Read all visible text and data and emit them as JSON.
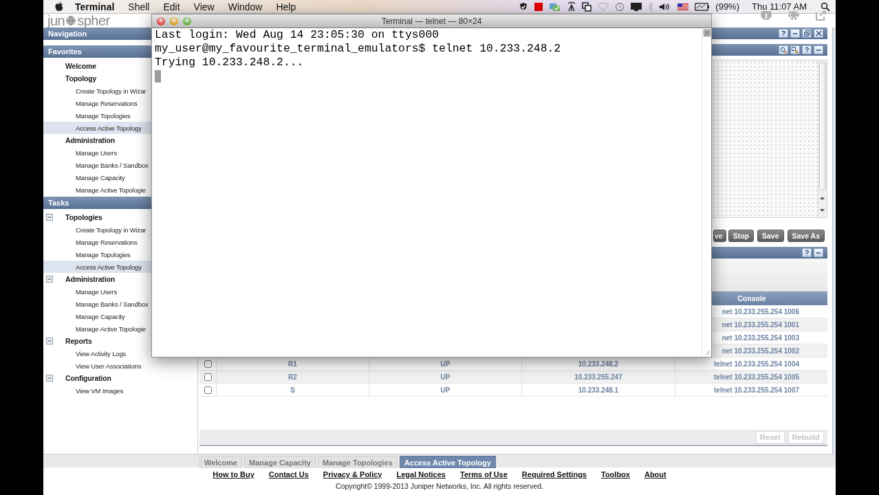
{
  "menu_bar": {
    "app": "Terminal",
    "menus": [
      "Shell",
      "Edit",
      "View",
      "Window",
      "Help"
    ],
    "battery": "(99%)",
    "clock": "Thu 11:07 AM"
  },
  "logo": {
    "before": "jun",
    "after": "spher"
  },
  "navigation": {
    "title": "Navigation"
  },
  "favorites": {
    "title": "Favorites",
    "groups": [
      {
        "label": "Welcome"
      },
      {
        "label": "Topology",
        "children": [
          {
            "label": "Create Topology in Wizar",
            "selected": false
          },
          {
            "label": "Manage Reservations",
            "selected": false
          },
          {
            "label": "Manage Topologies",
            "selected": false
          },
          {
            "label": "Access Active Topology",
            "selected": true
          }
        ]
      },
      {
        "label": "Administration",
        "children": [
          {
            "label": "Manage Users",
            "selected": false
          },
          {
            "label": "Manage Banks / Sandbox",
            "selected": false
          },
          {
            "label": "Manage Capacity",
            "selected": false
          },
          {
            "label": "Manage Active Topologie",
            "selected": false
          }
        ]
      }
    ]
  },
  "tasks": {
    "title": "Tasks",
    "groups": [
      {
        "label": "Topologies",
        "expanded": true,
        "children": [
          {
            "label": "Create Topology in Wizar",
            "selected": false
          },
          {
            "label": "Manage Reservations",
            "selected": false
          },
          {
            "label": "Manage Topologies",
            "selected": false
          },
          {
            "label": "Access Active Topology",
            "selected": true
          }
        ]
      },
      {
        "label": "Administration",
        "expanded": true,
        "children": [
          {
            "label": "Manage Users",
            "selected": false
          },
          {
            "label": "Manage Banks / Sandbox",
            "selected": false
          },
          {
            "label": "Manage Capacity",
            "selected": false
          },
          {
            "label": "Manage Active Topologie",
            "selected": false
          }
        ]
      },
      {
        "label": "Reports",
        "expanded": true,
        "children": [
          {
            "label": "View Activity Logs",
            "selected": false
          },
          {
            "label": "View User Associations",
            "selected": false
          }
        ]
      },
      {
        "label": "Configuration",
        "expanded": true,
        "children": [
          {
            "label": "View VM Images",
            "selected": false
          }
        ]
      }
    ]
  },
  "terminal": {
    "title": "Terminal — telnet — 80×24",
    "lines": [
      "Last login: Wed Aug 14 23:05:30 on ttys000",
      "my_user@my_favourite_terminal_emulators$ telnet 10.233.248.2",
      "Trying 10.233.248.2..."
    ]
  },
  "topology_toolbar": {
    "buttons": [
      "ve",
      "Stop",
      "Save",
      "Save As"
    ]
  },
  "devices_table": {
    "columns": [
      "Console"
    ],
    "rows": [
      {
        "console": "net 10.233.255.254 1006"
      },
      {
        "console": "net 10.233.255.254 1001"
      },
      {
        "console": "net 10.233.255.254 1003"
      },
      {
        "console": "net 10.233.255.254 1002"
      },
      {
        "checked": false,
        "column_2": "R1",
        "column_3": "UP",
        "column_4": "10.233.248.2",
        "console": "telnet 10.233.255.254 1004"
      },
      {
        "checked": false,
        "column_2": "R2",
        "column_3": "UP",
        "column_4": "10.233.255.247",
        "console": "telnet 10.233.255.254 1005"
      },
      {
        "checked": false,
        "column_2": "S",
        "column_3": "UP",
        "column_4": "10.233.248.1",
        "console": "telnet 10.233.255.254 1007"
      }
    ]
  },
  "action_buttons": [
    {
      "label": "Reset",
      "disabled": true
    },
    {
      "label": "Rebuild",
      "disabled": true
    }
  ],
  "bottom_tabs": [
    {
      "label": "Welcome",
      "selected": false
    },
    {
      "label": "Manage Capacity",
      "selected": false
    },
    {
      "label": "Manage Topologies",
      "selected": false
    },
    {
      "label": "Access Active Topology",
      "selected": true
    }
  ],
  "footer": {
    "links": [
      "How to Buy",
      "Contact Us",
      "Privacy & Policy",
      "Legal Notices",
      "Terms of Use",
      "Required Settings",
      "Toolbox",
      "About"
    ],
    "copyright": "Copyright© 1999-2013 Juniper Networks, Inc. All rights reserved."
  }
}
